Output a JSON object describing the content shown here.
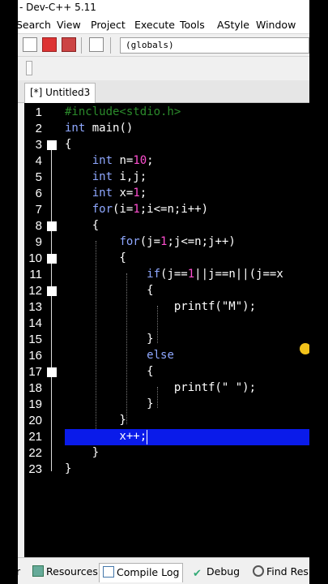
{
  "window": {
    "title": "- Dev-C++ 5.11"
  },
  "menu": [
    "Search",
    "View",
    "Project",
    "Execute",
    "Tools",
    "AStyle",
    "Window"
  ],
  "toolbar": {
    "scope_value": "(globals)"
  },
  "tabs": [
    {
      "label": "[*] Untitled3"
    }
  ],
  "editor": {
    "lines": [
      {
        "num": "1",
        "text": "#include<stdio.h>"
      },
      {
        "num": "2",
        "text": "int main()"
      },
      {
        "num": "3",
        "text": "{"
      },
      {
        "num": "4",
        "text": "    int n=10;"
      },
      {
        "num": "5",
        "text": "    int i,j;"
      },
      {
        "num": "6",
        "text": "    int x=1;"
      },
      {
        "num": "7",
        "text": "    for(i=1;i<=n;i++)"
      },
      {
        "num": "8",
        "text": "    {"
      },
      {
        "num": "9",
        "text": "        for(j=1;j<=n;j++)"
      },
      {
        "num": "10",
        "text": "        {"
      },
      {
        "num": "11",
        "text": "            if(j==1||j==n||(j==x"
      },
      {
        "num": "12",
        "text": "            {"
      },
      {
        "num": "13",
        "text": "                printf(\"M\");"
      },
      {
        "num": "14",
        "text": ""
      },
      {
        "num": "15",
        "text": "            }"
      },
      {
        "num": "16",
        "text": "            else"
      },
      {
        "num": "17",
        "text": "            {"
      },
      {
        "num": "18",
        "text": "                printf(\" \");"
      },
      {
        "num": "19",
        "text": "            }"
      },
      {
        "num": "20",
        "text": "        }"
      },
      {
        "num": "21",
        "text": "        x++;"
      },
      {
        "num": "22",
        "text": "    }"
      },
      {
        "num": "23",
        "text": "}"
      }
    ],
    "highlighted_line": "21"
  },
  "bottom_tabs": [
    {
      "label": "r",
      "icon": "truncated-tab"
    },
    {
      "label": "Resources",
      "icon": "resources-icon"
    },
    {
      "label": "Compile Log",
      "icon": "compile-log-icon"
    },
    {
      "label": "Debug",
      "icon": "debug-icon"
    },
    {
      "label": "Find Res",
      "icon": "find-results-icon"
    }
  ],
  "colors": {
    "editor_bg": "#000000",
    "keyword": "#8fa8ff",
    "number": "#ff4fd0",
    "preprocessor": "#2b8a2b",
    "selection": "#0a1bea",
    "caret_marker": "#f2c21a"
  }
}
